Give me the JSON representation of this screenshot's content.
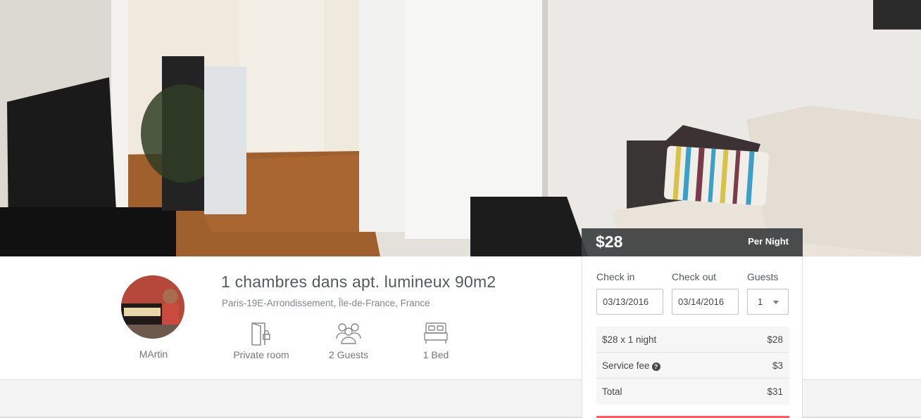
{
  "listing": {
    "title": "1 chambres dans apt. lumineux 90m2",
    "location": "Paris-19E-Arrondissement, Île-de-France, France"
  },
  "host": {
    "name": "MArtin"
  },
  "amenities": [
    {
      "icon": "door-icon",
      "label": "Private room"
    },
    {
      "icon": "guests-icon",
      "label": "2 Guests"
    },
    {
      "icon": "bed-icon",
      "label": "1 Bed"
    }
  ],
  "price": {
    "amount": "$28",
    "per": "Per Night"
  },
  "booking": {
    "checkin_label": "Check in",
    "checkout_label": "Check out",
    "guests_label": "Guests",
    "checkin_value": "03/13/2016",
    "checkout_value": "03/14/2016",
    "guests_value": "1",
    "breakdown": [
      {
        "label": "$28 x 1 night",
        "value": "$28"
      },
      {
        "label": "Service fee",
        "value": "$3"
      },
      {
        "label": "Total",
        "value": "$31"
      }
    ]
  },
  "colors": {
    "accent": "#ff5a5f",
    "price_bar": "#3c3f40",
    "text": "#484848"
  }
}
